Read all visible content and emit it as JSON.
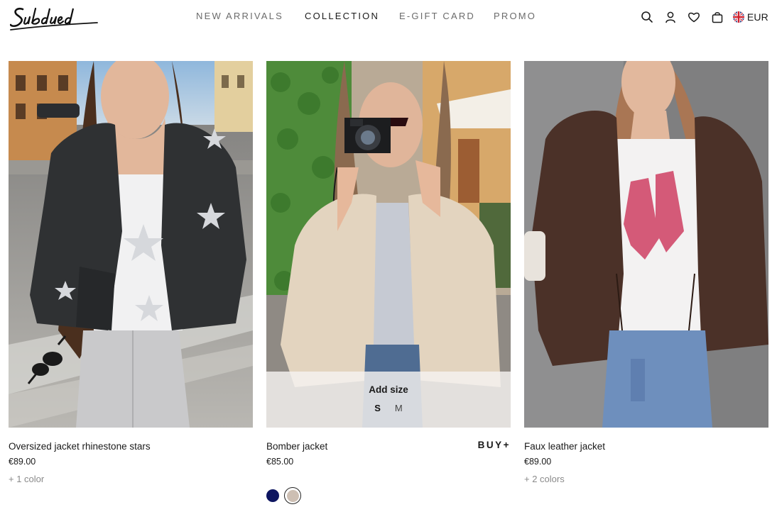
{
  "brand": {
    "logo_text": "Subdued"
  },
  "nav": {
    "items": [
      {
        "label": "NEW ARRIVALS",
        "active": false
      },
      {
        "label": "COLLECTION",
        "active": true
      },
      {
        "label": "E-GIFT CARD",
        "active": false
      },
      {
        "label": "PROMO",
        "active": false
      }
    ]
  },
  "toolbar": {
    "icons": [
      "search-icon",
      "user-icon",
      "heart-icon",
      "bag-icon"
    ],
    "currency": {
      "flag": "uk-flag-icon",
      "code": "EUR"
    }
  },
  "products": [
    {
      "name": "Oversized jacket rhinestone stars",
      "price": "€89.00",
      "more_colors": "+ 1 color"
    },
    {
      "name": "Bomber jacket",
      "price": "€85.00",
      "buy_label": "BUY+",
      "size_picker": {
        "title": "Add size",
        "sizes": [
          "S",
          "M"
        ]
      },
      "swatches": [
        {
          "color": "#0d1560",
          "selected": false
        },
        {
          "color": "#cdbfb3",
          "selected": true
        }
      ]
    },
    {
      "name": "Faux leather jacket",
      "price": "€89.00",
      "more_colors": "+ 2 colors"
    }
  ],
  "colors": {
    "text": "#1a1a1a",
    "nav_muted": "#6b6b6b",
    "muted": "#8a8a8a"
  }
}
